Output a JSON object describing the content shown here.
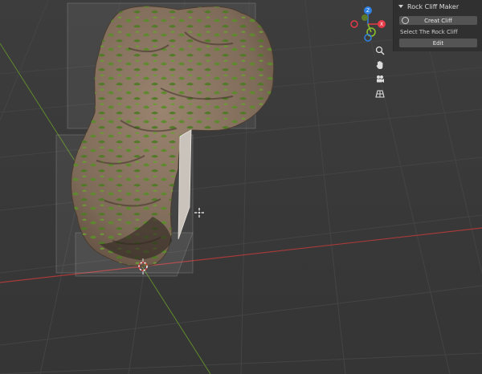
{
  "panel": {
    "title": "Rock Cliff Maker",
    "create_label": "Creat Cliff",
    "select_label": "Select The Rock Cliff",
    "edit_label": "Edit"
  },
  "gizmo": {
    "z_label": "Z",
    "y_label": "Y",
    "x_label": "X",
    "x_color": "#e53a47",
    "y_color": "#8ac22c",
    "z_color": "#2f80e0"
  },
  "nav_icons": [
    "zoom-icon",
    "hand-pan-icon",
    "camera-icon",
    "grid-view-icon"
  ]
}
